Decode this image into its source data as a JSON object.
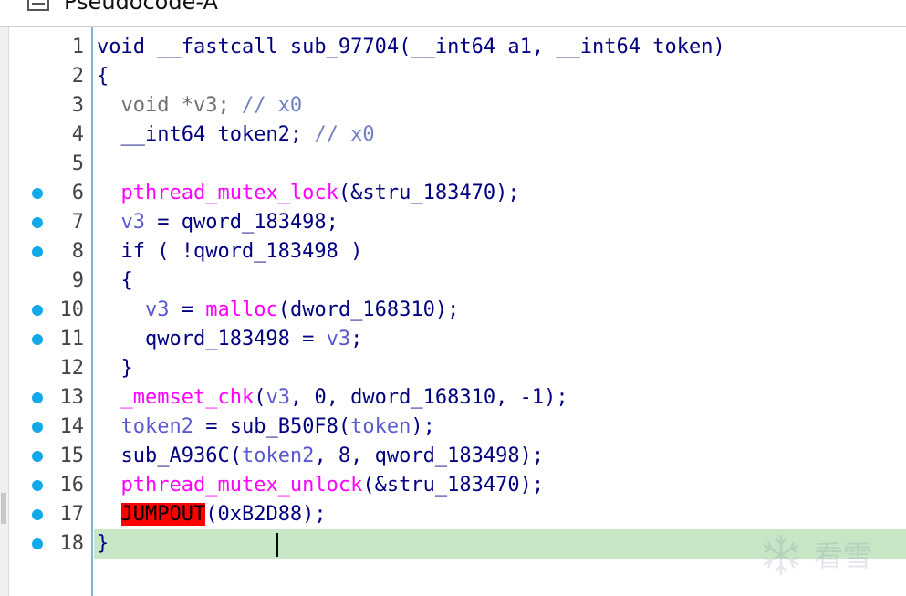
{
  "tab": {
    "title": "Pseudocode-A",
    "icon": "pseudocode-view-icon"
  },
  "colors": {
    "keyword": "#000080",
    "function": "#ff00ff",
    "local_var": "#5a5ad0",
    "comment": "#7080c0",
    "current_line": "#c6e6c6",
    "breakpoint_dot": "#13a9e8",
    "jumpout_bg": "#ff0000"
  },
  "code": {
    "lines": [
      {
        "num": "1",
        "bp": false,
        "tokens": [
          [
            "kw",
            "void __fastcall sub_97704(__int64 a1, __int64 token)"
          ]
        ]
      },
      {
        "num": "2",
        "bp": false,
        "tokens": [
          [
            "kw",
            "{"
          ]
        ]
      },
      {
        "num": "3",
        "bp": false,
        "tokens": [
          [
            "gray",
            "  void *v3; "
          ],
          [
            "cm",
            "// x0"
          ]
        ]
      },
      {
        "num": "4",
        "bp": false,
        "tokens": [
          [
            "kw",
            "  __int64 token2; "
          ],
          [
            "cm",
            "// x0"
          ]
        ]
      },
      {
        "num": "5",
        "bp": false,
        "tokens": [
          [
            "kw",
            ""
          ]
        ]
      },
      {
        "num": "6",
        "bp": true,
        "tokens": [
          [
            "kw",
            "  "
          ],
          [
            "fn",
            "pthread_mutex_lock"
          ],
          [
            "kw",
            "(&stru_183470);"
          ]
        ]
      },
      {
        "num": "7",
        "bp": true,
        "tokens": [
          [
            "kw",
            "  "
          ],
          [
            "lv",
            "v3"
          ],
          [
            "kw",
            " = qword_183498;"
          ]
        ]
      },
      {
        "num": "8",
        "bp": true,
        "tokens": [
          [
            "kw",
            "  if ( !qword_183498 )"
          ]
        ]
      },
      {
        "num": "9",
        "bp": false,
        "tokens": [
          [
            "kw",
            "  {"
          ]
        ]
      },
      {
        "num": "10",
        "bp": true,
        "tokens": [
          [
            "kw",
            "    "
          ],
          [
            "lv",
            "v3"
          ],
          [
            "kw",
            " = "
          ],
          [
            "fn",
            "malloc"
          ],
          [
            "kw",
            "(dword_168310);"
          ]
        ]
      },
      {
        "num": "11",
        "bp": true,
        "tokens": [
          [
            "kw",
            "    qword_183498 = "
          ],
          [
            "lv",
            "v3"
          ],
          [
            "kw",
            ";"
          ]
        ]
      },
      {
        "num": "12",
        "bp": false,
        "tokens": [
          [
            "kw",
            "  }"
          ]
        ]
      },
      {
        "num": "13",
        "bp": true,
        "tokens": [
          [
            "kw",
            "  "
          ],
          [
            "fn",
            "_memset_chk"
          ],
          [
            "kw",
            "("
          ],
          [
            "lv",
            "v3"
          ],
          [
            "kw",
            ", 0, dword_168310, -1);"
          ]
        ]
      },
      {
        "num": "14",
        "bp": true,
        "tokens": [
          [
            "kw",
            "  "
          ],
          [
            "lv",
            "token2"
          ],
          [
            "kw",
            " = sub_B50F8("
          ],
          [
            "lv",
            "token"
          ],
          [
            "kw",
            ");"
          ]
        ]
      },
      {
        "num": "15",
        "bp": true,
        "tokens": [
          [
            "kw",
            "  sub_A936C("
          ],
          [
            "lv",
            "token2"
          ],
          [
            "kw",
            ", 8, qword_183498);"
          ]
        ]
      },
      {
        "num": "16",
        "bp": true,
        "tokens": [
          [
            "kw",
            "  "
          ],
          [
            "fn",
            "pthread_mutex_unlock"
          ],
          [
            "kw",
            "(&stru_183470);"
          ]
        ]
      },
      {
        "num": "17",
        "bp": true,
        "tokens": [
          [
            "kw",
            "  "
          ],
          [
            "bad",
            "JUMPOUT"
          ],
          [
            "kw",
            "(0xB2D88);"
          ]
        ]
      },
      {
        "num": "18",
        "bp": true,
        "current": true,
        "tokens": [
          [
            "kw",
            "}"
          ]
        ]
      }
    ]
  },
  "watermark": {
    "text": "看雪",
    "icon": "snowflake-logo-icon"
  }
}
